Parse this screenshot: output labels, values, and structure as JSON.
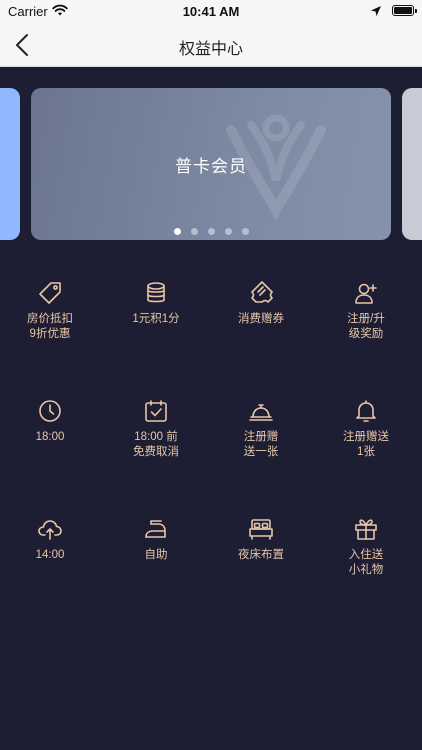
{
  "status": {
    "carrier": "Carrier",
    "time": "10:41 AM"
  },
  "nav": {
    "title": "权益中心"
  },
  "carousel": {
    "card_title": "普卡会员",
    "dots": 5,
    "active_dot": 0
  },
  "benefits": [
    {
      "icon": "price-tag-icon",
      "label": "房价抵扣\n9折优惠"
    },
    {
      "icon": "coins-icon",
      "label": "1元积1分"
    },
    {
      "icon": "ticket-icon",
      "label": "消费赠券"
    },
    {
      "icon": "add-user-icon",
      "label": "注册/升\n级奖励"
    },
    {
      "icon": "clock-icon",
      "label": "18:00"
    },
    {
      "icon": "calendar-check-icon",
      "label": "18:00 前\n免费取消"
    },
    {
      "icon": "service-bell-icon",
      "label": "注册赠\n送一张"
    },
    {
      "icon": "bell-icon",
      "label": "注册赠送\n1张"
    },
    {
      "icon": "cloud-upload-icon",
      "label": "14:00"
    },
    {
      "icon": "iron-icon",
      "label": "自助"
    },
    {
      "icon": "bed-icon",
      "label": "夜床布置"
    },
    {
      "icon": "gift-icon",
      "label": "入住送\n小礼物"
    }
  ],
  "colors": {
    "accent": "#e8c6a8",
    "background": "#1d1e33"
  }
}
